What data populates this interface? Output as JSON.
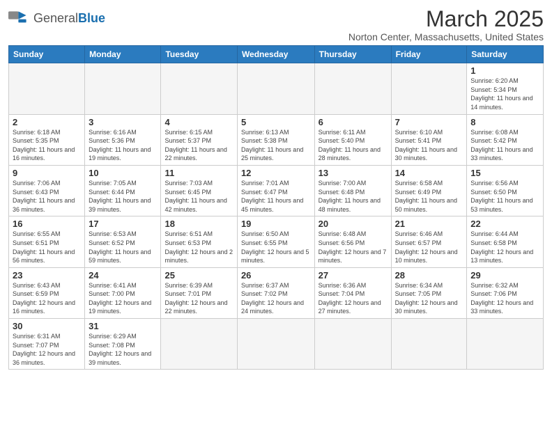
{
  "header": {
    "logo_general": "General",
    "logo_blue": "Blue",
    "month_title": "March 2025",
    "subtitle": "Norton Center, Massachusetts, United States"
  },
  "days_of_week": [
    "Sunday",
    "Monday",
    "Tuesday",
    "Wednesday",
    "Thursday",
    "Friday",
    "Saturday"
  ],
  "weeks": [
    [
      {
        "day": "",
        "info": "",
        "empty": true
      },
      {
        "day": "",
        "info": "",
        "empty": true
      },
      {
        "day": "",
        "info": "",
        "empty": true
      },
      {
        "day": "",
        "info": "",
        "empty": true
      },
      {
        "day": "",
        "info": "",
        "empty": true
      },
      {
        "day": "",
        "info": "",
        "empty": true
      },
      {
        "day": "1",
        "info": "Sunrise: 6:20 AM\nSunset: 5:34 PM\nDaylight: 11 hours and 14 minutes."
      }
    ],
    [
      {
        "day": "2",
        "info": "Sunrise: 6:18 AM\nSunset: 5:35 PM\nDaylight: 11 hours and 16 minutes."
      },
      {
        "day": "3",
        "info": "Sunrise: 6:16 AM\nSunset: 5:36 PM\nDaylight: 11 hours and 19 minutes."
      },
      {
        "day": "4",
        "info": "Sunrise: 6:15 AM\nSunset: 5:37 PM\nDaylight: 11 hours and 22 minutes."
      },
      {
        "day": "5",
        "info": "Sunrise: 6:13 AM\nSunset: 5:38 PM\nDaylight: 11 hours and 25 minutes."
      },
      {
        "day": "6",
        "info": "Sunrise: 6:11 AM\nSunset: 5:40 PM\nDaylight: 11 hours and 28 minutes."
      },
      {
        "day": "7",
        "info": "Sunrise: 6:10 AM\nSunset: 5:41 PM\nDaylight: 11 hours and 30 minutes."
      },
      {
        "day": "8",
        "info": "Sunrise: 6:08 AM\nSunset: 5:42 PM\nDaylight: 11 hours and 33 minutes."
      }
    ],
    [
      {
        "day": "9",
        "info": "Sunrise: 7:06 AM\nSunset: 6:43 PM\nDaylight: 11 hours and 36 minutes."
      },
      {
        "day": "10",
        "info": "Sunrise: 7:05 AM\nSunset: 6:44 PM\nDaylight: 11 hours and 39 minutes."
      },
      {
        "day": "11",
        "info": "Sunrise: 7:03 AM\nSunset: 6:45 PM\nDaylight: 11 hours and 42 minutes."
      },
      {
        "day": "12",
        "info": "Sunrise: 7:01 AM\nSunset: 6:47 PM\nDaylight: 11 hours and 45 minutes."
      },
      {
        "day": "13",
        "info": "Sunrise: 7:00 AM\nSunset: 6:48 PM\nDaylight: 11 hours and 48 minutes."
      },
      {
        "day": "14",
        "info": "Sunrise: 6:58 AM\nSunset: 6:49 PM\nDaylight: 11 hours and 50 minutes."
      },
      {
        "day": "15",
        "info": "Sunrise: 6:56 AM\nSunset: 6:50 PM\nDaylight: 11 hours and 53 minutes."
      }
    ],
    [
      {
        "day": "16",
        "info": "Sunrise: 6:55 AM\nSunset: 6:51 PM\nDaylight: 11 hours and 56 minutes."
      },
      {
        "day": "17",
        "info": "Sunrise: 6:53 AM\nSunset: 6:52 PM\nDaylight: 11 hours and 59 minutes."
      },
      {
        "day": "18",
        "info": "Sunrise: 6:51 AM\nSunset: 6:53 PM\nDaylight: 12 hours and 2 minutes."
      },
      {
        "day": "19",
        "info": "Sunrise: 6:50 AM\nSunset: 6:55 PM\nDaylight: 12 hours and 5 minutes."
      },
      {
        "day": "20",
        "info": "Sunrise: 6:48 AM\nSunset: 6:56 PM\nDaylight: 12 hours and 7 minutes."
      },
      {
        "day": "21",
        "info": "Sunrise: 6:46 AM\nSunset: 6:57 PM\nDaylight: 12 hours and 10 minutes."
      },
      {
        "day": "22",
        "info": "Sunrise: 6:44 AM\nSunset: 6:58 PM\nDaylight: 12 hours and 13 minutes."
      }
    ],
    [
      {
        "day": "23",
        "info": "Sunrise: 6:43 AM\nSunset: 6:59 PM\nDaylight: 12 hours and 16 minutes."
      },
      {
        "day": "24",
        "info": "Sunrise: 6:41 AM\nSunset: 7:00 PM\nDaylight: 12 hours and 19 minutes."
      },
      {
        "day": "25",
        "info": "Sunrise: 6:39 AM\nSunset: 7:01 PM\nDaylight: 12 hours and 22 minutes."
      },
      {
        "day": "26",
        "info": "Sunrise: 6:37 AM\nSunset: 7:02 PM\nDaylight: 12 hours and 24 minutes."
      },
      {
        "day": "27",
        "info": "Sunrise: 6:36 AM\nSunset: 7:04 PM\nDaylight: 12 hours and 27 minutes."
      },
      {
        "day": "28",
        "info": "Sunrise: 6:34 AM\nSunset: 7:05 PM\nDaylight: 12 hours and 30 minutes."
      },
      {
        "day": "29",
        "info": "Sunrise: 6:32 AM\nSunset: 7:06 PM\nDaylight: 12 hours and 33 minutes."
      }
    ],
    [
      {
        "day": "30",
        "info": "Sunrise: 6:31 AM\nSunset: 7:07 PM\nDaylight: 12 hours and 36 minutes."
      },
      {
        "day": "31",
        "info": "Sunrise: 6:29 AM\nSunset: 7:08 PM\nDaylight: 12 hours and 39 minutes."
      },
      {
        "day": "",
        "info": "",
        "empty": true
      },
      {
        "day": "",
        "info": "",
        "empty": true
      },
      {
        "day": "",
        "info": "",
        "empty": true
      },
      {
        "day": "",
        "info": "",
        "empty": true
      },
      {
        "day": "",
        "info": "",
        "empty": true
      }
    ]
  ]
}
